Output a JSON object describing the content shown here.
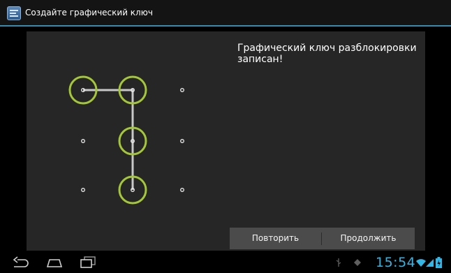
{
  "titlebar": {
    "title": "Создайте графический ключ",
    "icon": "settings-app-icon"
  },
  "message": "Графический ключ разблокировки записан!",
  "buttons": {
    "retry": "Повторить",
    "continue": "Продолжить"
  },
  "pattern": {
    "grid": [
      3,
      3
    ],
    "sequence": [
      1,
      2,
      5,
      8
    ],
    "accent_color": "#a4c639",
    "line_color": "#c8c8c8"
  },
  "navbar": {
    "buttons": [
      "back-icon",
      "home-icon",
      "recent-apps-icon"
    ],
    "status_icons": [
      "usb-icon",
      "android-debug-icon",
      "wifi-icon",
      "signal-icon",
      "battery-icon"
    ],
    "time": "15:54",
    "time_color": "#33b5e5"
  }
}
